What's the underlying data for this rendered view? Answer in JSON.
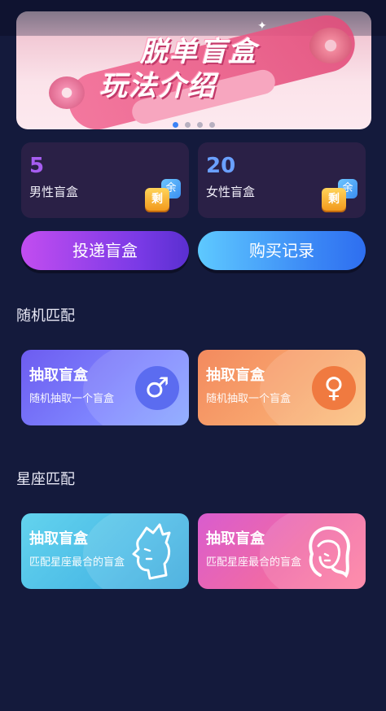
{
  "banner": {
    "title_line1": "脱单盲盒",
    "title_line2": "玩法介绍",
    "slides": 4,
    "active_slide": 1
  },
  "stats": [
    {
      "count": "5",
      "label": "男性盲盒",
      "badge_top": "余",
      "badge_bottom": "剩"
    },
    {
      "count": "20",
      "label": "女性盲盒",
      "badge_top": "余",
      "badge_bottom": "剩"
    }
  ],
  "actions": {
    "deliver_label": "投递盲盒",
    "records_label": "购买记录"
  },
  "sections": {
    "random_title": "随机匹配",
    "constellation_title": "星座匹配"
  },
  "cards": {
    "random_male": {
      "title": "抽取盲盒",
      "subtitle": "随机抽取一个盲盒",
      "symbol": "♂",
      "icon": "male-symbol-icon"
    },
    "random_female": {
      "title": "抽取盲盒",
      "subtitle": "随机抽取一个盲盒",
      "symbol": "♀",
      "icon": "female-symbol-icon"
    },
    "constellation_male": {
      "title": "抽取盲盒",
      "subtitle": "匹配星座最合的盲盒",
      "icon": "male-head-icon"
    },
    "constellation_female": {
      "title": "抽取盲盒",
      "subtitle": "匹配星座最合的盲盒",
      "icon": "female-head-icon"
    }
  },
  "colors": {
    "background": "#141a3c",
    "deliver_button": "#7a3ae6",
    "records_button": "#3a86f5",
    "slide_active": "#3b82f6"
  }
}
